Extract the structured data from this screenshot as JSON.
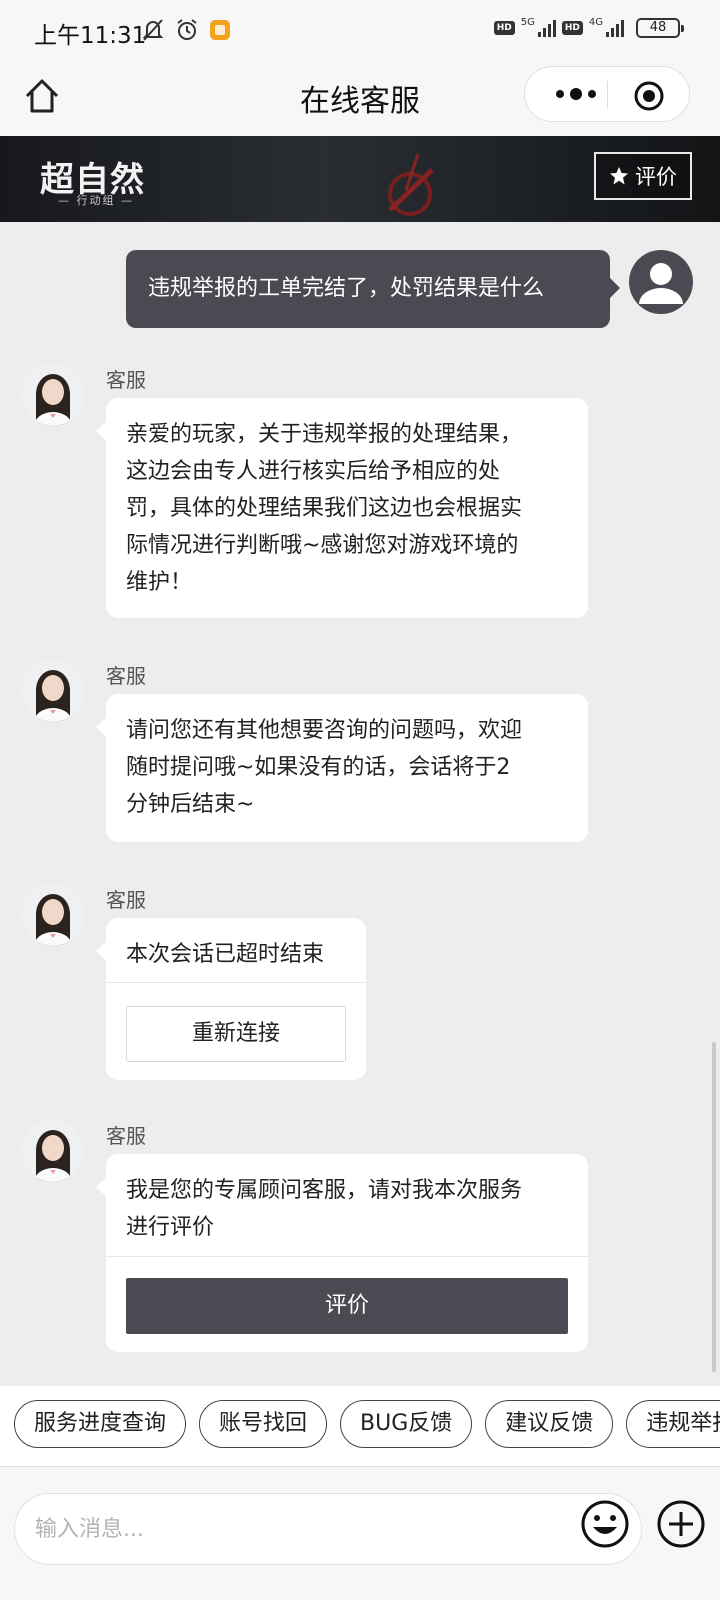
{
  "status_bar": {
    "time": "上午11:31",
    "network_1": "5G",
    "network_2": "4G",
    "hd_1": "HD",
    "hd_2": "HD",
    "battery": "48"
  },
  "nav": {
    "title": "在线客服"
  },
  "banner": {
    "logo_text": "超自然",
    "logo_sub": "— 行动组 —",
    "rate_label": "评价"
  },
  "chat": {
    "user_message": "违规举报的工单完结了，处罚结果是什么",
    "agent_name": "客服",
    "messages": [
      {
        "lines": [
          "亲爱的玩家，关于违规举报的处理结果，",
          "这边会由专人进行核实后给予相应的处",
          "罚，具体的处理结果我们这边也会根据实",
          "际情况进行判断哦~感谢您对游戏环境的",
          "维护！"
        ]
      },
      {
        "lines": [
          "请问您还有其他想要咨询的问题吗，欢迎",
          "随时提问哦~如果没有的话，会话将于2",
          "分钟后结束~"
        ]
      },
      {
        "lines": [
          "本次会话已超时结束"
        ],
        "button": "重新连接"
      },
      {
        "lines": [
          "我是您的专属顾问客服，请对我本次服务",
          "进行评价"
        ],
        "button": "评价"
      }
    ]
  },
  "quick_replies": [
    "服务进度查询",
    "账号找回",
    "BUG反馈",
    "建议反馈",
    "违规举报"
  ],
  "input": {
    "placeholder": "输入消息..."
  }
}
